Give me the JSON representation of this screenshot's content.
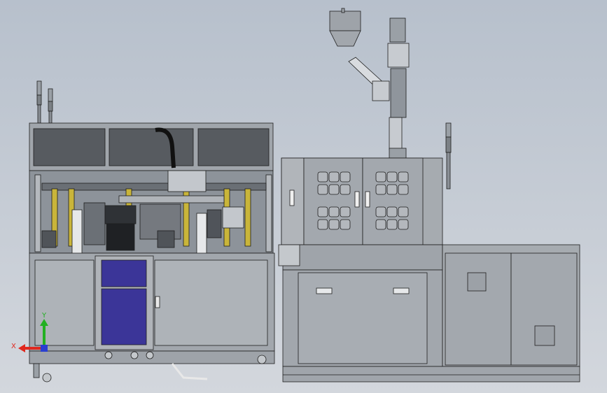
{
  "viewport": {
    "background_top": "#b7c0cc",
    "background_bottom": "#d3d7dd"
  },
  "triad": {
    "x_label": "X",
    "y_label": "Y",
    "x_color": "#e0281e",
    "y_color": "#22b022",
    "z_color": "#2a3fd0"
  },
  "colors": {
    "frame": "#8f959c",
    "panel": "#a8adb3",
    "panel_dark": "#4f5358",
    "door_purple": "#3b3598",
    "line": "#1e1e1e",
    "accent_yellow": "#c9b53a"
  }
}
